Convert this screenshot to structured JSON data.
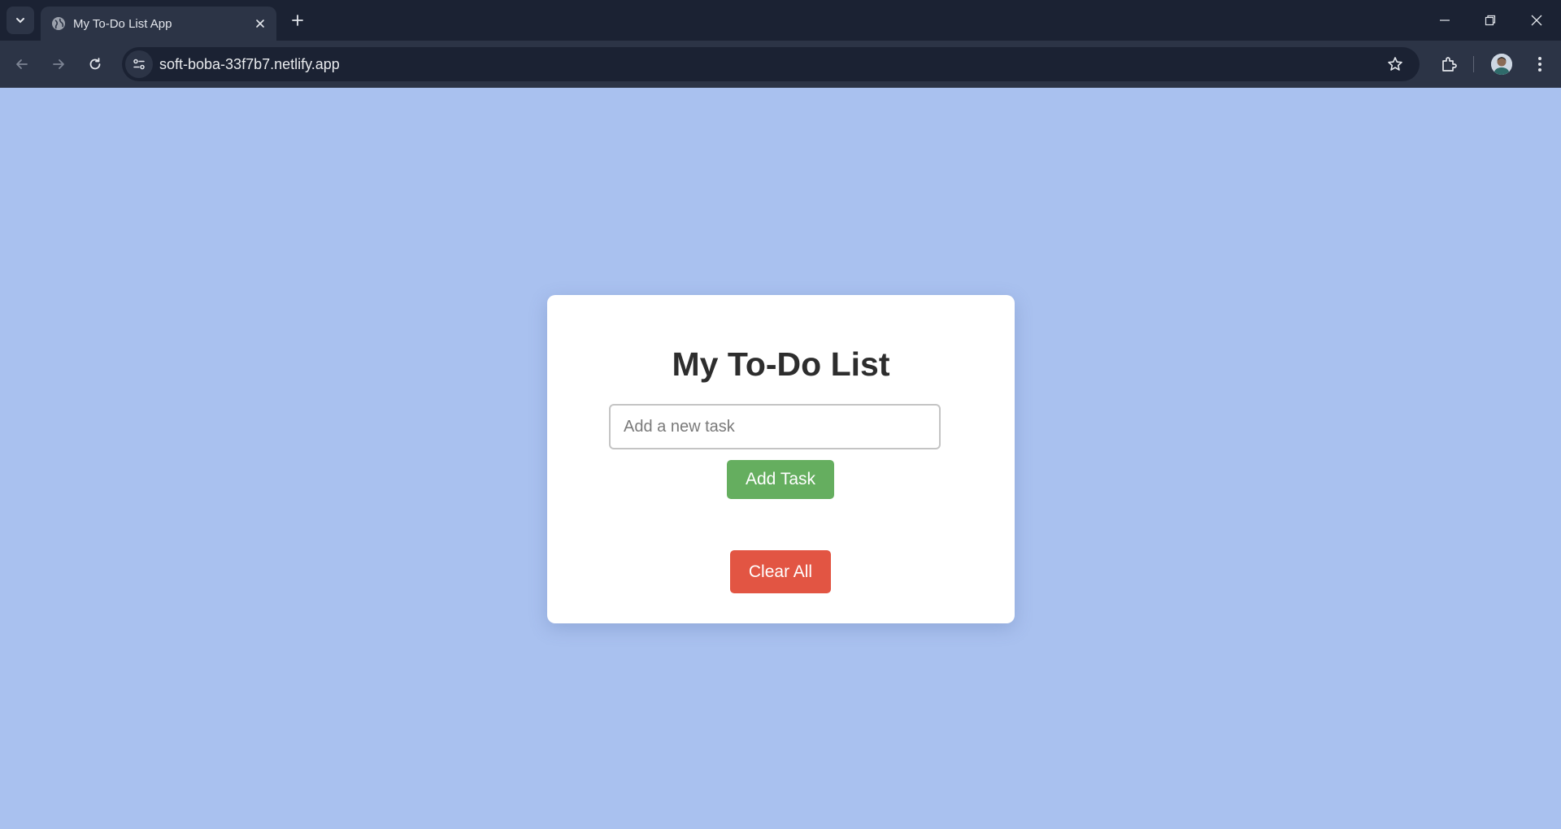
{
  "browser": {
    "tab": {
      "title": "My To-Do List App",
      "favicon": "globe-icon"
    },
    "address_bar": {
      "url": "soft-boba-33f7b7.netlify.app"
    },
    "icons": [
      "chevron-down-icon",
      "close-icon",
      "plus-icon",
      "minimize-icon",
      "restore-icon",
      "window-close-icon",
      "back-arrow-icon",
      "forward-arrow-icon",
      "reload-icon",
      "site-info-icon",
      "star-icon",
      "extensions-icon",
      "avatar",
      "kebab-menu-icon"
    ]
  },
  "app": {
    "title": "My To-Do List",
    "input": {
      "placeholder": "Add a new task",
      "value": ""
    },
    "add_button_label": "Add Task",
    "clear_button_label": "Clear All",
    "tasks": []
  },
  "colors": {
    "page_background": "#a9c1ef",
    "add_button": "#65ae5f",
    "clear_button": "#e25543",
    "chrome_dark": "#1b2233",
    "chrome_toolbar": "#2c3446"
  }
}
